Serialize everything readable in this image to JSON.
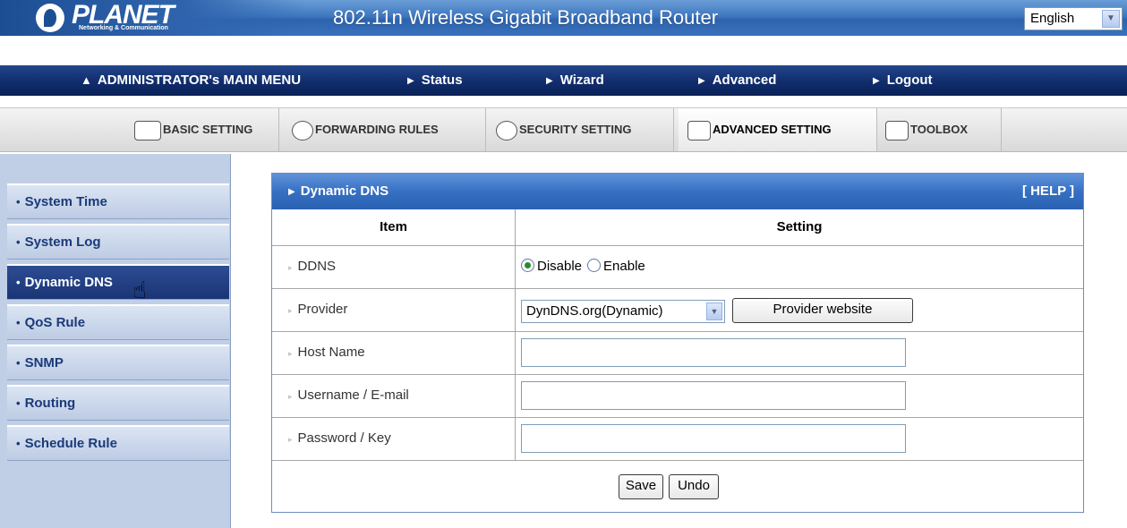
{
  "header": {
    "logo": "PLANET",
    "logo_tagline": "Networking & Communication",
    "title": "802.11n Wireless Gigabit Broadband Router",
    "language": "English"
  },
  "main_menu": {
    "admin": "ADMINISTRATOR's MAIN MENU",
    "status": "Status",
    "wizard": "Wizard",
    "advanced": "Advanced",
    "logout": "Logout"
  },
  "tabs": {
    "basic": "BASIC SETTING",
    "forwarding": "FORWARDING RULES",
    "security": "SECURITY SETTING",
    "advanced": "ADVANCED SETTING",
    "toolbox": "TOOLBOX"
  },
  "sidebar": {
    "items": [
      {
        "label": "System Time"
      },
      {
        "label": "System Log"
      },
      {
        "label": "Dynamic DNS"
      },
      {
        "label": "QoS Rule"
      },
      {
        "label": "SNMP"
      },
      {
        "label": "Routing"
      },
      {
        "label": "Schedule Rule"
      }
    ],
    "active": "Dynamic DNS"
  },
  "panel": {
    "title": "Dynamic DNS",
    "help": "[ HELP ]",
    "col_item": "Item",
    "col_setting": "Setting",
    "rows": {
      "ddns": {
        "label": "DDNS",
        "disable": "Disable",
        "enable": "Enable",
        "selected": "Disable"
      },
      "provider": {
        "label": "Provider",
        "value": "DynDNS.org(Dynamic)",
        "website_button": "Provider website"
      },
      "host_name": {
        "label": "Host Name",
        "value": ""
      },
      "username": {
        "label": "Username / E-mail",
        "value": ""
      },
      "password": {
        "label": "Password / Key",
        "value": ""
      }
    },
    "save_button": "Save",
    "undo_button": "Undo"
  },
  "colors": {
    "header_blue": "#3f78c0",
    "menu_navy": "#102d6c",
    "sidebar_bg": "#c1cfe6",
    "sidebar_active": "#1a3576"
  }
}
